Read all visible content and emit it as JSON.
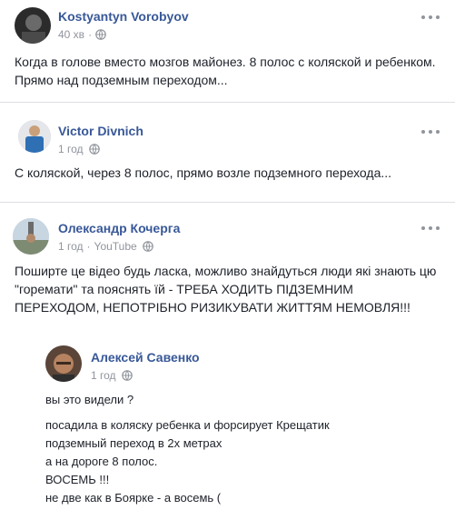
{
  "posts": [
    {
      "author": "Kostyantyn Vorobyov",
      "time": "40 хв",
      "lines": [
        "Когда в голове вместо мозгов майонез. 8 полос с коляской и ребенком.",
        "Прямо над подземным переходом..."
      ]
    },
    {
      "author": "Victor Divnich",
      "time": "1 год",
      "lines": [
        "С коляской, через 8 полос, прямо возле подземного перехода..."
      ]
    },
    {
      "author": "Олександр Кочерга",
      "time": "1 год",
      "source": "YouTube",
      "lines": [
        "Поширте це відео будь ласка, можливо знайдуться люди які знають цю",
        "\"горемати\" та пояснять їй - ТРЕБА ХОДИТЬ ПІДЗЕМНИМ",
        "ПЕРЕХОДОМ, НЕПОТРІБНО РИЗИКУВАТИ ЖИТТЯМ НЕМОВЛЯ!!!"
      ]
    },
    {
      "author": "Алексей Савенко",
      "time": "1 год",
      "lines": [
        "вы это видели ?",
        "посадила в коляску ребенка и форсирует Крещатик",
        "подземный переход в 2х метрах",
        "а на дороге 8 полос.",
        "ВОСЕМЬ !!!",
        "не две как в Боярке - а восемь ("
      ]
    }
  ],
  "colors": {
    "author_link": "#385898",
    "meta_text": "#90949c",
    "divider": "#dddfe2"
  },
  "icons": {
    "globe": "globe-icon",
    "more": "more-options-icon"
  }
}
